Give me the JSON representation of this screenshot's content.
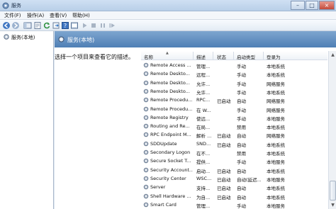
{
  "window": {
    "title": "服务"
  },
  "menu": [
    {
      "label": "文件(F)"
    },
    {
      "label": "操作(A)"
    },
    {
      "label": "查看(V)"
    },
    {
      "label": "帮助(H)"
    }
  ],
  "tree": {
    "root_label": "服务(本地)"
  },
  "header": {
    "title": "服务(本地)"
  },
  "description": {
    "prompt": "选择一个项目来查看它的描述。"
  },
  "columns": {
    "name": "名称",
    "description": "描述",
    "status": "状态",
    "startup": "启动类型",
    "logon": "登录为"
  },
  "services": [
    {
      "name": "Remote Access ...",
      "desc": "管理...",
      "status": "",
      "startup": "手动",
      "logon": "本地系统"
    },
    {
      "name": "Remote Deskto...",
      "desc": "远程...",
      "status": "",
      "startup": "手动",
      "logon": "本地系统"
    },
    {
      "name": "Remote Deskto...",
      "desc": "允许...",
      "status": "",
      "startup": "手动",
      "logon": "网络服务"
    },
    {
      "name": "Remote Deskto...",
      "desc": "允许...",
      "status": "",
      "startup": "手动",
      "logon": "本地系统"
    },
    {
      "name": "Remote Procedu...",
      "desc": "RPC...",
      "status": "已启动",
      "startup": "自动",
      "logon": "网络服务"
    },
    {
      "name": "Remote Procedu...",
      "desc": "在 W...",
      "status": "",
      "startup": "手动",
      "logon": "网络服务"
    },
    {
      "name": "Remote Registry",
      "desc": "使远...",
      "status": "",
      "startup": "手动",
      "logon": "本地服务"
    },
    {
      "name": "Routing and Re...",
      "desc": "在局...",
      "status": "",
      "startup": "禁用",
      "logon": "本地系统"
    },
    {
      "name": "RPC Endpoint M...",
      "desc": "解析 ...",
      "status": "已启动",
      "startup": "自动",
      "logon": "网络服务"
    },
    {
      "name": "SDDUpdate",
      "desc": "SND...",
      "status": "已启动",
      "startup": "自动",
      "logon": "本地系统"
    },
    {
      "name": "Secondary Logon",
      "desc": "在不...",
      "status": "",
      "startup": "禁用",
      "logon": "本地系统"
    },
    {
      "name": "Secure Socket T...",
      "desc": "提供...",
      "status": "",
      "startup": "手动",
      "logon": "本地服务"
    },
    {
      "name": "Security Account...",
      "desc": "启动...",
      "status": "已启动",
      "startup": "自动",
      "logon": "本地系统"
    },
    {
      "name": "Security Center",
      "desc": "WSC...",
      "status": "已启动",
      "startup": "自动(延迟...",
      "logon": "本地服务"
    },
    {
      "name": "Server",
      "desc": "支持...",
      "status": "已启动",
      "startup": "自动",
      "logon": "本地系统"
    },
    {
      "name": "Shell Hardware ...",
      "desc": "为自...",
      "status": "已启动",
      "startup": "自动",
      "logon": "本地系统"
    },
    {
      "name": "Smart Card",
      "desc": "管理...",
      "status": "",
      "startup": "手动",
      "logon": "本地服务"
    }
  ],
  "colors": {
    "header_gradient_top": "#7da5cf",
    "header_gradient_bottom": "#4f7fb5",
    "titlebar": "#c5d8ee"
  },
  "icons": [
    "services-app-icon",
    "back-arrow-icon",
    "forward-arrow-icon",
    "console-tree-icon",
    "properties-icon",
    "refresh-icon",
    "export-icon",
    "help-icon",
    "console-icon",
    "play-icon",
    "stop-icon",
    "pause-icon",
    "restart-icon",
    "gear-icon"
  ]
}
